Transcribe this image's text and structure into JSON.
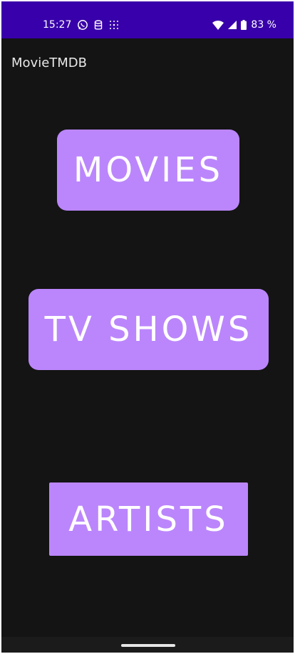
{
  "status_bar": {
    "time": "15:27",
    "battery": "83 %",
    "icons": [
      "whatsapp-icon",
      "database-icon",
      "dots-grid-icon",
      "wifi-icon",
      "signal-icon",
      "battery-icon"
    ]
  },
  "app_bar": {
    "title": "MovieTMDB"
  },
  "buttons": {
    "movies": "MOVIES",
    "tv_shows": "TV SHOWS",
    "artists": "ARTISTS"
  },
  "colors": {
    "status_bar": "#3800aa",
    "background": "#141414",
    "button": "#bb86fc",
    "button_text": "#ffffff"
  }
}
